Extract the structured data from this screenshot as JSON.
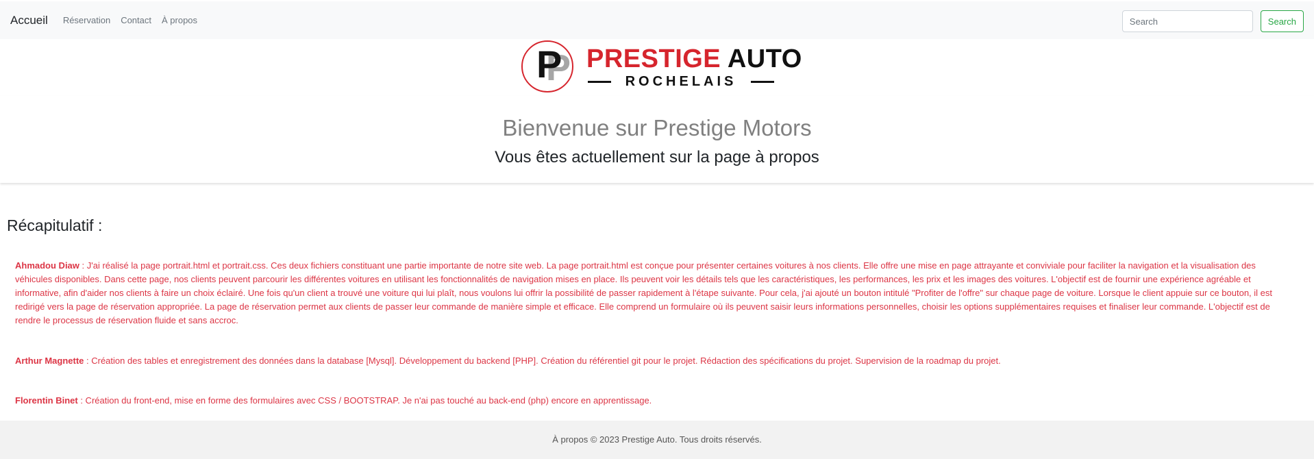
{
  "navbar": {
    "brand": "Accueil",
    "links": [
      "Réservation",
      "Contact",
      "À propos"
    ],
    "search_placeholder": "Search",
    "search_button": "Search"
  },
  "logo": {
    "letter": "P",
    "title_red": "PRESTIGE",
    "title_black": "AUTO",
    "subtitle": "ROCHELAIS"
  },
  "hero": {
    "title": "Bienvenue sur Prestige Motors",
    "subtitle": "Vous êtes actuellement sur la page à propos"
  },
  "recap": {
    "title": "Récapitulatif :",
    "contributors": [
      {
        "name": "Ahmadou Diaw",
        "text": " : J'ai réalisé la page portrait.html et portrait.css. Ces deux fichiers constituant une partie importante de notre site web. La page portrait.html est conçue pour présenter certaines voitures à nos clients. Elle offre une mise en page attrayante et conviviale pour faciliter la navigation et la visualisation des véhicules disponibles. Dans cette page, nos clients peuvent parcourir les différentes voitures en utilisant les fonctionnalités de navigation mises en place. Ils peuvent voir les détails tels que les caractéristiques, les performances, les prix et les images des voitures. L'objectif est de fournir une expérience agréable et informative, afin d'aider nos clients à faire un choix éclairé. Une fois qu'un client a trouvé une voiture qui lui plaît, nous voulons lui offrir la possibilité de passer rapidement à l'étape suivante. Pour cela, j'ai ajouté un bouton intitulé \"Profiter de l'offre\" sur chaque page de voiture. Lorsque le client appuie sur ce bouton, il est redirigé vers la page de réservation appropriée. La page de réservation permet aux clients de passer leur commande de manière simple et efficace. Elle comprend un formulaire où ils peuvent saisir leurs informations personnelles, choisir les options supplémentaires requises et finaliser leur commande. L'objectif est de rendre le processus de réservation fluide et sans accroc."
      },
      {
        "name": "Arthur Magnette",
        "text": " : Création des tables et enregistrement des données dans la database [Mysql]. Développement du backend [PHP]. Création du référentiel git pour le projet. Rédaction des spécifications du projet. Supervision de la roadmap du projet."
      },
      {
        "name": "Florentin Binet",
        "text": " : Création du front-end, mise en forme des formulaires avec CSS / BOOTSTRAP. Je n'ai pas touché au back-end (php) encore en apprentissage."
      }
    ]
  },
  "footer": {
    "text": "À propos © 2023 Prestige Auto. Tous droits réservés."
  },
  "colors": {
    "brand_red": "#d6252d",
    "contributor_text": "#dc3545",
    "search_green": "#28a745",
    "navbar_bg": "#f8f9fa",
    "footer_bg": "#f2f2f2"
  }
}
